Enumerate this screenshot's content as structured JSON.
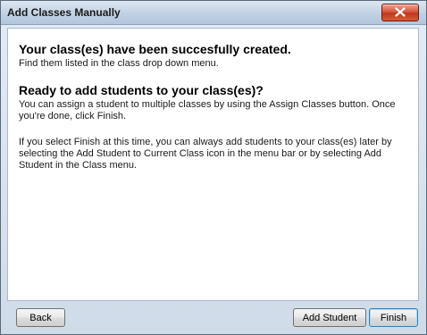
{
  "window": {
    "title": "Add Classes Manually",
    "close_icon": "close-icon"
  },
  "content": {
    "success_heading": "Your class(es) have been succesfully created.",
    "success_text": "Find them listed in the class drop down menu.",
    "ready_heading": "Ready to add students to your class(es)?",
    "ready_text": "You can assign a student to multiple classes by using the Assign Classes button.  Once you're done, click Finish.",
    "finish_text": "If you select Finish at this time, you can always add students to your class(es) later by selecting the Add Student to Current Class icon in the menu bar or by selecting Add Student in the Class menu."
  },
  "buttons": {
    "back": "Back",
    "add_student": "Add Student",
    "finish": "Finish"
  },
  "colors": {
    "title_bar": "#c3d3e5",
    "close_button": "#c0381e",
    "primary_border": "#3c7fb1"
  }
}
